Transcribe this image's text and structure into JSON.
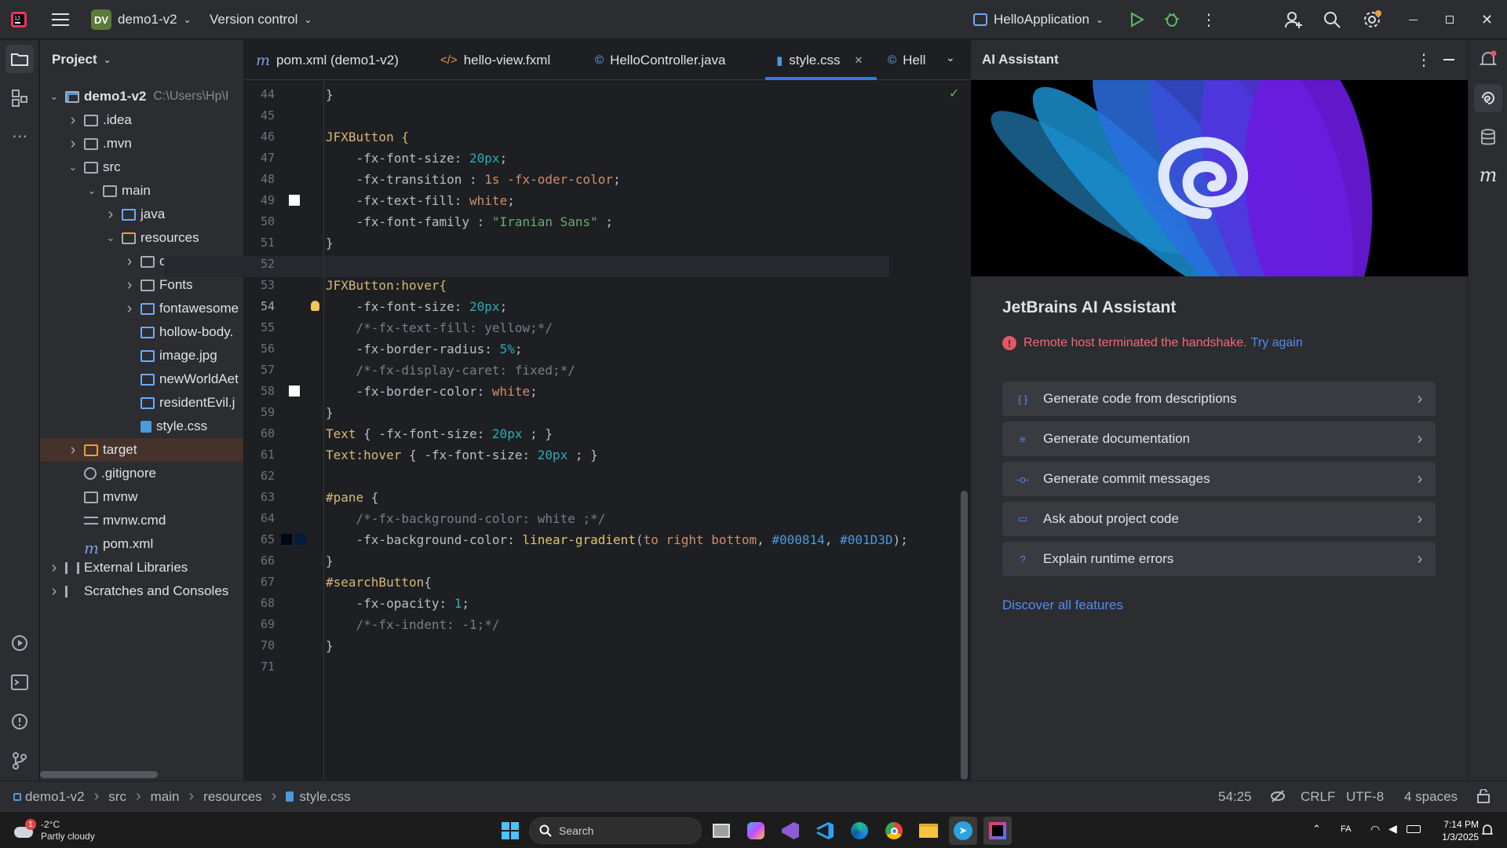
{
  "titlebar": {
    "project_badge": "DV",
    "project_name": "demo1-v2",
    "vcs": "Version control",
    "run_config": "HelloApplication"
  },
  "project_panel": {
    "title": "Project",
    "tree": [
      {
        "label": "demo1-v2",
        "suffix": "C:\\Users\\Hp\\I",
        "depth": 0,
        "exp": "open",
        "type": "module"
      },
      {
        "label": ".idea",
        "depth": 1,
        "exp": "closed",
        "type": "folder"
      },
      {
        "label": ".mvn",
        "depth": 1,
        "exp": "closed",
        "type": "folder"
      },
      {
        "label": "src",
        "depth": 1,
        "exp": "open",
        "type": "folder"
      },
      {
        "label": "main",
        "depth": 2,
        "exp": "open",
        "type": "folder"
      },
      {
        "label": "java",
        "depth": 3,
        "exp": "closed",
        "type": "folder-blue"
      },
      {
        "label": "resources",
        "depth": 3,
        "exp": "open",
        "type": "folder-res"
      },
      {
        "label": "com",
        "depth": 4,
        "exp": "closed",
        "type": "folder"
      },
      {
        "label": "Fonts",
        "depth": 4,
        "exp": "closed",
        "type": "folder"
      },
      {
        "label": "fontawesome",
        "depth": 4,
        "exp": "closed",
        "type": "img"
      },
      {
        "label": "hollow-body.",
        "depth": 4,
        "exp": "none",
        "type": "img"
      },
      {
        "label": "image.jpg",
        "depth": 4,
        "exp": "none",
        "type": "img"
      },
      {
        "label": "newWorldAet",
        "depth": 4,
        "exp": "none",
        "type": "img"
      },
      {
        "label": "residentEvil.j",
        "depth": 4,
        "exp": "none",
        "type": "img"
      },
      {
        "label": "style.css",
        "depth": 4,
        "exp": "none",
        "type": "css"
      },
      {
        "label": "target",
        "depth": 1,
        "exp": "closed",
        "type": "folder-orange",
        "highlight": true
      },
      {
        "label": ".gitignore",
        "depth": 1,
        "exp": "none",
        "type": "ignore"
      },
      {
        "label": "mvnw",
        "depth": 1,
        "exp": "none",
        "type": "term"
      },
      {
        "label": "mvnw.cmd",
        "depth": 1,
        "exp": "none",
        "type": "text"
      },
      {
        "label": "pom.xml",
        "depth": 1,
        "exp": "none",
        "type": "maven"
      },
      {
        "label": "External Libraries",
        "depth": 0,
        "exp": "closed",
        "type": "lib"
      },
      {
        "label": "Scratches and Consoles",
        "depth": 0,
        "exp": "closed",
        "type": "scratch"
      }
    ]
  },
  "tabs": [
    {
      "label": "pom.xml (demo1-v2)",
      "icon": "m",
      "icon_color": "#7a9ee0"
    },
    {
      "label": "hello-view.fxml",
      "icon": "</>",
      "icon_color": "#e8a03a"
    },
    {
      "label": "HelloController.java",
      "icon": "©",
      "icon_color": "#6fa8ff"
    },
    {
      "label": "style.css",
      "icon": "css",
      "icon_color": "#4a9bdb",
      "active": true
    },
    {
      "label": "Hell",
      "icon": "©",
      "icon_color": "#6fa8ff"
    }
  ],
  "editor": {
    "line_start": 44,
    "lines": [
      [
        [
          "}",
          "prop"
        ]
      ],
      [],
      [
        [
          "JFXButton {",
          "sel"
        ]
      ],
      [
        [
          "    -fx-font-size: ",
          "prop"
        ],
        [
          "20px",
          "num"
        ],
        [
          ";",
          "prop"
        ]
      ],
      [
        [
          "    -fx-transition : ",
          "prop"
        ],
        [
          "1s -fx-oder-color",
          "val"
        ],
        [
          ";",
          "prop"
        ]
      ],
      [
        [
          "    -fx-text-fill: ",
          "prop"
        ],
        [
          "white",
          "val"
        ],
        [
          ";",
          "prop"
        ]
      ],
      [
        [
          "    -fx-font-family : ",
          "prop"
        ],
        [
          "\"Iranian Sans\"",
          "str"
        ],
        [
          " ;",
          "prop"
        ]
      ],
      [
        [
          "}",
          "prop"
        ]
      ],
      [],
      [
        [
          "JFXButton:hover{",
          "sel"
        ]
      ],
      [
        [
          "    -fx-font-size: ",
          "prop"
        ],
        [
          "20px",
          "num"
        ],
        [
          ";",
          "prop"
        ]
      ],
      [
        [
          "    /*-fx-text-fill: yellow;*/",
          "cmt"
        ]
      ],
      [
        [
          "    -fx-border-radius: ",
          "prop"
        ],
        [
          "5%",
          "num"
        ],
        [
          ";",
          "prop"
        ]
      ],
      [
        [
          "    /*-fx-display-caret: fixed;*/",
          "cmt"
        ]
      ],
      [
        [
          "    -fx-border-color: ",
          "prop"
        ],
        [
          "white",
          "val"
        ],
        [
          ";",
          "prop"
        ]
      ],
      [
        [
          "}",
          "prop"
        ]
      ],
      [
        [
          "Text",
          "sel"
        ],
        [
          " { -fx-font-size: ",
          "prop"
        ],
        [
          "20px",
          "num"
        ],
        [
          " ; }",
          "prop"
        ]
      ],
      [
        [
          "Text:hover",
          "sel"
        ],
        [
          " { -fx-font-size: ",
          "prop"
        ],
        [
          "20px",
          "num"
        ],
        [
          " ; }",
          "prop"
        ]
      ],
      [],
      [
        [
          "#pane",
          "sel"
        ],
        [
          " {",
          "prop"
        ]
      ],
      [
        [
          "    /*-fx-background-color: white ;*/",
          "cmt"
        ]
      ],
      [
        [
          "    -fx-background-color: ",
          "prop"
        ],
        [
          "linear-gradient",
          "fn"
        ],
        [
          "(",
          "prop"
        ],
        [
          "to right bottom",
          "val"
        ],
        [
          ", ",
          "prop"
        ],
        [
          "#000814",
          "hex"
        ],
        [
          ", ",
          "prop"
        ],
        [
          "#001D3D",
          "hex"
        ],
        [
          ");",
          "prop"
        ]
      ],
      [
        [
          "}",
          "prop"
        ]
      ],
      [
        [
          "#searchButton",
          "sel"
        ],
        [
          "{",
          "prop"
        ]
      ],
      [
        [
          "    -fx-opacity: ",
          "prop"
        ],
        [
          "1",
          "num"
        ],
        [
          ";",
          "prop"
        ]
      ],
      [
        [
          "    /*-fx-indent: -1;*/",
          "cmt"
        ]
      ],
      [
        [
          "}",
          "prop"
        ]
      ],
      []
    ],
    "current_line": 54
  },
  "ai": {
    "header": "AI Assistant",
    "title": "JetBrains AI Assistant",
    "error": "Remote host terminated the handshake.",
    "retry": "Try again",
    "actions": [
      "Generate code from descriptions",
      "Generate documentation",
      "Generate commit messages",
      "Ask about project code",
      "Explain runtime errors"
    ],
    "discover": "Discover all features"
  },
  "statusbar": {
    "crumbs": [
      "demo1-v2",
      "src",
      "main",
      "resources",
      "style.css"
    ],
    "position": "54:25",
    "line_sep": "CRLF",
    "encoding": "UTF-8",
    "indent": "4 spaces"
  },
  "taskbar": {
    "temp": "-2°C",
    "weather": "Partly cloudy",
    "weather_badge": "1",
    "search": "Search",
    "time": "7:14 PM",
    "date": "1/3/2025",
    "lang": "FA"
  }
}
